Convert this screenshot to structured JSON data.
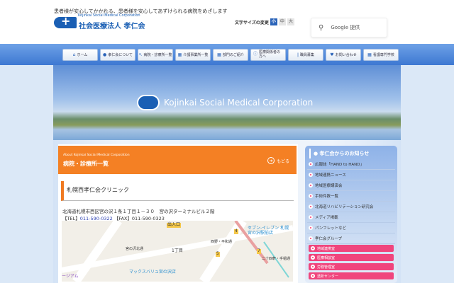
{
  "header": {
    "tagline": "患者様が安心してかかれる、患者様を安心してあずけられる病院をめざします",
    "logo_sub": "Kojinkai Social Medical Corporation",
    "logo_name": "社会医療法人 孝仁会",
    "font_size_label": "文字サイズの変更",
    "font_sizes": [
      "小",
      "中",
      "大"
    ],
    "search_placeholder": "Google 提供"
  },
  "nav": [
    "ホーム",
    "孝仁会について",
    "病院・診療所一覧",
    "介護事業所一覧",
    "部門のご紹介",
    "医療関係者の方へ",
    "職員募集",
    "お問い合わせ",
    "看護専門学校"
  ],
  "banner": {
    "title": "Kojinkai Social Medical Corporation"
  },
  "section": {
    "subtitle": "About Kojinkai Social Medical Corporation",
    "title": "病院・診療所一覧",
    "back": "もどる"
  },
  "clinic": {
    "name": "札幌西孝仁会クリニック",
    "address": "北海道札幌市西区宮の沢１条１丁目１－３０　宮の沢ターミナルビル２階",
    "tel_label": "【TEL】",
    "tel": "011-590-0322",
    "fax_label": "【FAX】",
    "fax": "011-590-0323"
  },
  "map": {
    "labels": [
      "出入口",
      "1丁目",
      "宮の沢北通",
      "西野・平和通",
      "セブン-イレブン 札幌宮の沢駅前店",
      "マックスバリュ宮の沢店",
      "ージアム",
      "二十四軒・手稲通"
    ],
    "markers": [
      "4",
      "5",
      "7"
    ]
  },
  "sidebar": {
    "title": "孝仁会からのお知らせ",
    "items": [
      "広報誌「HAND to HAND」",
      "地域連携ニュース",
      "地域医療講演会",
      "手術件数一覧",
      "北海道リハビリテーション研究会",
      "メディア掲載",
      "パンフレットなど",
      "孝仁会グループ"
    ],
    "pink_items": [
      "地域連携室",
      "医療相談室",
      "労務管理室",
      "透析センター"
    ]
  }
}
